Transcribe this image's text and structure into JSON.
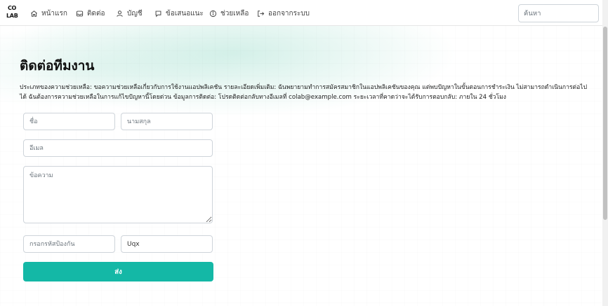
{
  "brand": {
    "logo_line1": "CO",
    "logo_line2": "LAB"
  },
  "nav": {
    "items": [
      {
        "label": "หน้าแรก",
        "icon": "home-icon"
      },
      {
        "label": "ติดต่อ",
        "icon": "inbox-icon"
      },
      {
        "label": "บัญชี",
        "icon": "user-icon"
      },
      {
        "label": "ข้อเสนอแนะ",
        "icon": "chat-icon"
      },
      {
        "label": "ช่วยเหลือ",
        "icon": "info-icon"
      },
      {
        "label": "ออกจากระบบ",
        "icon": "logout-icon"
      }
    ],
    "search_placeholder": "ค้นหา"
  },
  "page": {
    "title": "ติดต่อทีมงาน",
    "description": "ประเภทของความช่วยเหลือ: ขอความช่วยเหลือเกี่ยวกับการใช้งานแอปพลิเคชัน รายละเอียดเพิ่มเติม: ฉันพยายามทำการสมัครสมาชิกในแอปพลิเคชันของคุณ แต่พบปัญหาในขั้นตอนการชำระเงิน ไม่สามารถดำเนินการต่อไปได้ ฉันต้องการความช่วยเหลือในการแก้ไขปัญหานี้โดยด่วน ข้อมูลการติดต่อ: โปรดติดต่อกลับทางอีเมลที่ colab@example.com ระยะเวลาที่คาดว่าจะได้รับการตอบกลับ: ภายใน 24 ชั่วโมง"
  },
  "form": {
    "first_name_placeholder": "ชื่อ",
    "last_name_placeholder": "นามสกุล",
    "email_placeholder": "อีเมล",
    "message_placeholder": "ข้อความ",
    "captcha_placeholder": "กรอกรหัสป้องกัน",
    "captcha_code": "Uqx",
    "submit_label": "ส่ง"
  },
  "colors": {
    "accent": "#14b8a6",
    "glow": "#8cd7c3"
  }
}
